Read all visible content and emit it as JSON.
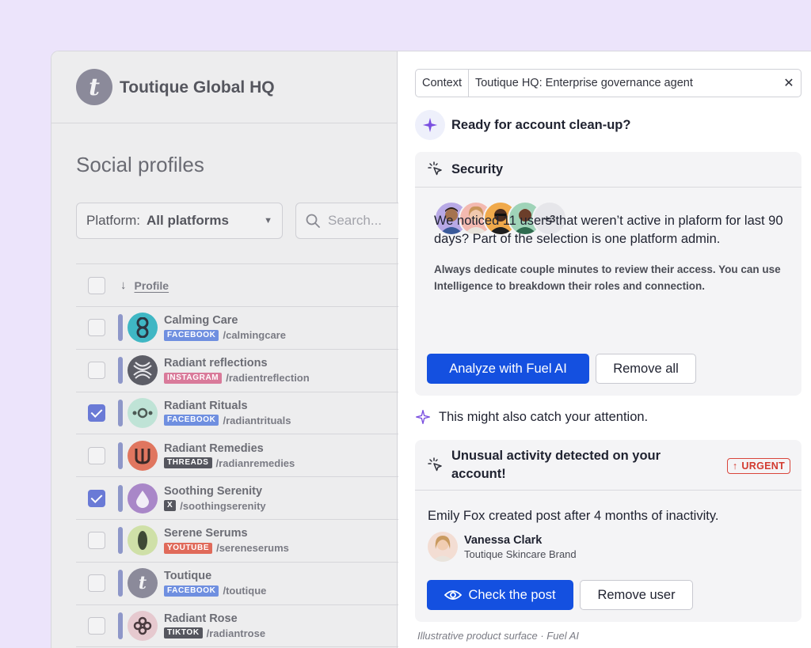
{
  "org": {
    "name": "Toutique Global HQ",
    "logo_letter": "t"
  },
  "left": {
    "section_title": "Social profiles",
    "filter": {
      "label": "Platform:",
      "value": "All platforms"
    },
    "search": {
      "placeholder": "Search..."
    },
    "table": {
      "header": "Profile",
      "rows": [
        {
          "name": "Calming Care",
          "platform": "FACEBOOK",
          "handle": "/calmingcare",
          "checked": false
        },
        {
          "name": "Radiant reflections",
          "platform": "INSTAGRAM",
          "handle": "/radientreflection",
          "checked": false
        },
        {
          "name": "Radiant Rituals",
          "platform": "FACEBOOK",
          "handle": "/radiantrituals",
          "checked": true
        },
        {
          "name": "Radiant Remedies",
          "platform": "THREADS",
          "handle": "/radianremedies",
          "checked": false
        },
        {
          "name": "Soothing Serenity",
          "platform": "X",
          "handle": "/soothingserenity",
          "checked": true
        },
        {
          "name": "Serene Serums",
          "platform": "YOUTUBE",
          "handle": "/sereneserums",
          "checked": false
        },
        {
          "name": "Toutique",
          "platform": "FACEBOOK",
          "handle": "/toutique",
          "checked": false
        },
        {
          "name": "Radiant Rose",
          "platform": "TIKTOK",
          "handle": "/radiantrose",
          "checked": false
        }
      ]
    }
  },
  "colors": {
    "primary": "#1450e0",
    "urgent": "#d23a2f",
    "facebook": "#6f8fe0",
    "instagram": "#d97a9a",
    "threads": "#55565e",
    "x": "#55565e",
    "youtube": "#e06a5a",
    "tiktok": "#55565e",
    "background": "#ece4fb"
  },
  "context": {
    "label": "Context",
    "value": "Toutique HQ: Enterprise governance agent"
  },
  "assistant": {
    "ready": "Ready for account clean-up?",
    "security": {
      "title": "Security",
      "more_count": "+3",
      "text": "We noticed 11 users that weren’t active in plaform for last 90 days? Part of the selection is one platform admin.",
      "note": "Always dedicate couple minutes to review their access. You can use Intelligence to breakdown their roles and connection.",
      "primary_button": "Analyze with Fuel AI",
      "secondary_button": "Remove all"
    },
    "attention": "This might also catch your attention.",
    "activity": {
      "title": "Unusual activity detected on your account!",
      "badge": "URGENT",
      "text": "Emily Fox created post after 4 months of inactivity.",
      "user_name": "Vanessa Clark",
      "user_org": "Toutique Skincare Brand",
      "primary_button": "Check the post",
      "secondary_button": "Remove user"
    }
  },
  "footer": "Illustrative product surface · Fuel AI"
}
